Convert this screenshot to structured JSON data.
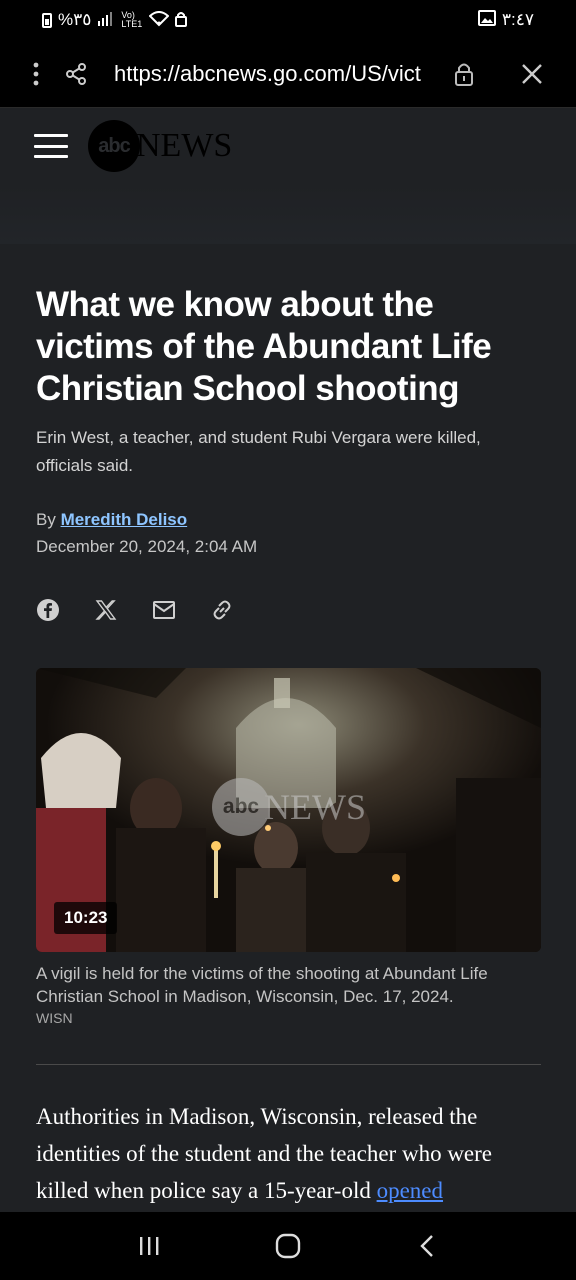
{
  "status_bar": {
    "battery_text": "%٣٥",
    "network_text": "Vo) LTE1",
    "time": "٣:٤٧"
  },
  "browser": {
    "url": "https://abcnews.go.com/US/vict"
  },
  "site": {
    "logo_abc": "abc",
    "logo_news": "NEWS"
  },
  "article": {
    "headline": "What we know about the victims of the Abundant Life Christian School shooting",
    "subheadline": "Erin West, a teacher, and student Rubi Vergara were killed, officials said.",
    "byline_prefix": "By ",
    "author": "Meredith Deliso",
    "date": "December 20, 2024, 2:04 AM",
    "video": {
      "duration": "10:23",
      "watermark_abc": "abc",
      "watermark_news": "NEWS"
    },
    "caption": "A vigil is held for the victims of the shooting at Abundant Life Christian School in Madison, Wisconsin, Dec. 17, 2024.",
    "credit": "WISN",
    "body_text": "Authorities in Madison, Wisconsin, released the identities of the student and the teacher who were killed when police say a 15-year-old ",
    "body_link": "opened"
  }
}
